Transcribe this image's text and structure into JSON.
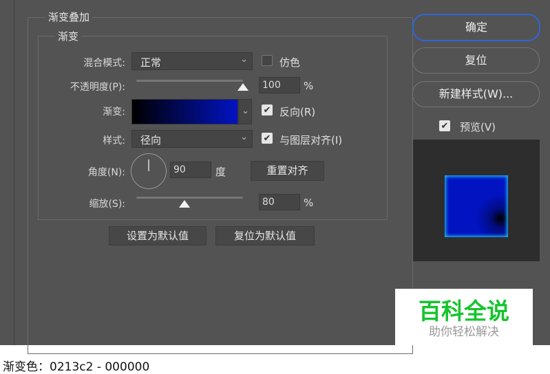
{
  "section_title": "渐变叠加",
  "group_title": "渐变",
  "blend_mode": {
    "label": "混合模式:",
    "value": "正常"
  },
  "dither": {
    "label": "仿色",
    "checked": false
  },
  "opacity": {
    "label": "不透明度(P):",
    "value": "100",
    "unit": "%",
    "fraction": 1.0
  },
  "gradient": {
    "label": "渐变:",
    "colors": [
      "#000000",
      "#0213c2"
    ]
  },
  "reverse": {
    "label": "反向(R)",
    "checked": true
  },
  "style": {
    "label": "样式:",
    "value": "径向"
  },
  "align": {
    "label": "与图层对齐(I)",
    "checked": true
  },
  "angle": {
    "label": "角度(N):",
    "value": "90",
    "unit": "度"
  },
  "reset_align": "重置对齐",
  "scale": {
    "label": "缩放(S):",
    "value": "80",
    "unit": "%",
    "fraction": 0.46
  },
  "set_default": "设置为默认值",
  "reset_default": "复位为默认值",
  "buttons": {
    "ok": "确定",
    "reset": "复位",
    "new_style": "新建样式(W)..."
  },
  "preview": {
    "label": "预览(V)",
    "checked": true
  },
  "watermark": {
    "title": "百科全说",
    "subtitle": "助你轻松解决"
  },
  "caption": "渐变色：0213c2 - 000000"
}
